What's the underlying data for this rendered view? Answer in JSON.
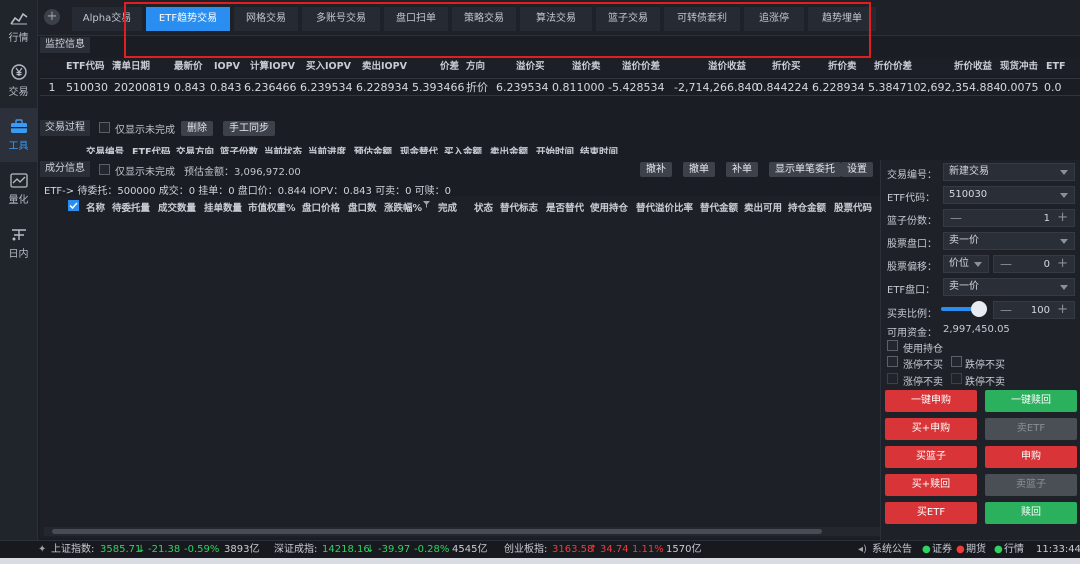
{
  "nav": [
    {
      "label": "行情",
      "icon": "chart-icon"
    },
    {
      "label": "交易",
      "icon": "yen-coin-icon"
    },
    {
      "label": "工具",
      "icon": "toolbox-icon"
    },
    {
      "label": "量化",
      "icon": "quant-icon"
    },
    {
      "label": "日内",
      "icon": "intraday-icon"
    }
  ],
  "tabs": [
    "Alpha交易",
    "ETF趋势交易",
    "网格交易",
    "多账号交易",
    "盘口扫单",
    "策略交易",
    "算法交易",
    "篮子交易",
    "可转债套利",
    "追涨停",
    "趋势埋单"
  ],
  "monitor": {
    "title": "监控信息",
    "columns": [
      "ETF代码",
      "清单日期",
      "最新价",
      "IOPV",
      "计算IOPV",
      "买入IOPV",
      "卖出IOPV",
      "价差",
      "方向",
      "溢价买",
      "溢价卖",
      "溢价价差",
      "溢价收益",
      "折价买",
      "折价卖",
      "折价价差",
      "折价收益",
      "现货冲击",
      "ETF"
    ],
    "row": [
      "1",
      "510030",
      "20200819",
      "0.843",
      "0.843",
      "6.236466",
      "6.239534",
      "6.228934",
      "5.393466",
      "折价",
      "6.239534",
      "0.811000",
      "-5.428534",
      "-2,714,266.840",
      "0.844224",
      "6.228934",
      "5.384710",
      "2,692,354.884",
      "0.0075",
      "0.0"
    ]
  },
  "process": {
    "title": "交易过程",
    "only_incomplete": "仅显示未完成",
    "delete": "删除",
    "manual_sync": "手工同步",
    "columns": [
      "交易编号",
      "ETF代码",
      "交易方向",
      "篮子份数",
      "当前状态",
      "当前进度",
      "预估金额",
      "现金替代",
      "买入金额",
      "卖出金额",
      "开始时间",
      "结束时间"
    ]
  },
  "component": {
    "title": "成分信息",
    "only_incomplete": "仅显示未完成",
    "estimate": "预估金额：3,096,972.00",
    "buttons": [
      "撤补",
      "撤单",
      "补单",
      "显示单笔委托",
      "设置"
    ],
    "etf_line": "ETF->  待委托：500000   成交：0   挂单：0   盘口价：0.844   IOPV：0.843   可卖：0   可赎：0",
    "columns": [
      "名称",
      "待委托量",
      "成交数量",
      "挂单数量",
      "市值权重%",
      "盘口价格",
      "盘口数",
      "涨跌幅%",
      "完成",
      "状态",
      "替代标志",
      "是否替代",
      "使用持仓",
      "替代溢价比率",
      "替代金额",
      "卖出可用",
      "持仓金额",
      "股票代码"
    ]
  },
  "form": {
    "trade_no_label": "交易编号：",
    "trade_no": "新建交易",
    "etf_code_label": "ETF代码：",
    "etf_code": "510030",
    "basket_label": "篮子份数：",
    "basket": "1",
    "stock_book_label": "股票盘口：",
    "stock_book": "卖一价",
    "stock_offset_label": "股票偏移：",
    "stock_offset_unit": "价位",
    "stock_offset": "0",
    "etf_book_label": "ETF盘口：",
    "etf_book": "卖一价",
    "ratio_label": "买卖比例：",
    "ratio": "100",
    "ratio_slider_fraction": 1.0,
    "funds_label": "可用资金：",
    "funds": "2,997,450.05",
    "use_position": "使用持仓",
    "no_buy_up": "涨停不买",
    "no_buy_down": "跌停不买",
    "no_sell_up": "涨停不卖",
    "no_sell_down": "跌停不卖",
    "btn_one_subscribe": "一键申购",
    "btn_one_redeem": "一键赎回",
    "btn_buy_subscribe": "买+申购",
    "btn_sell_etf": "卖ETF",
    "btn_buy_basket": "买篮子",
    "btn_subscribe": "申购",
    "btn_buy_redeem": "买+赎回",
    "btn_sell_basket": "卖篮子",
    "btn_buy_etf": "买ETF",
    "btn_redeem": "赎回"
  },
  "status": {
    "sh_label": "上证指数:",
    "sh_val": "3585.71",
    "sh_chg": "-21.38",
    "sh_pct": "-0.59%",
    "sh_amt": "3893亿",
    "sz_label": "深证成指:",
    "sz_val": "14218.16",
    "sz_chg": "-39.97",
    "sz_pct": "-0.28%",
    "sz_amt": "4545亿",
    "cy_label": "创业板指:",
    "cy_val": "3163.58",
    "cy_chg": "34.74",
    "cy_pct": "1.11%",
    "cy_amt": "1570亿",
    "notice": "系统公告",
    "sec": "证券",
    "fut": "期货",
    "quote": "行情",
    "time": "11:33:44"
  },
  "colors": {
    "accent": "#2a8ef0",
    "red": "#d93437",
    "green": "#2bb05e",
    "highlight_box": "#e02020"
  }
}
